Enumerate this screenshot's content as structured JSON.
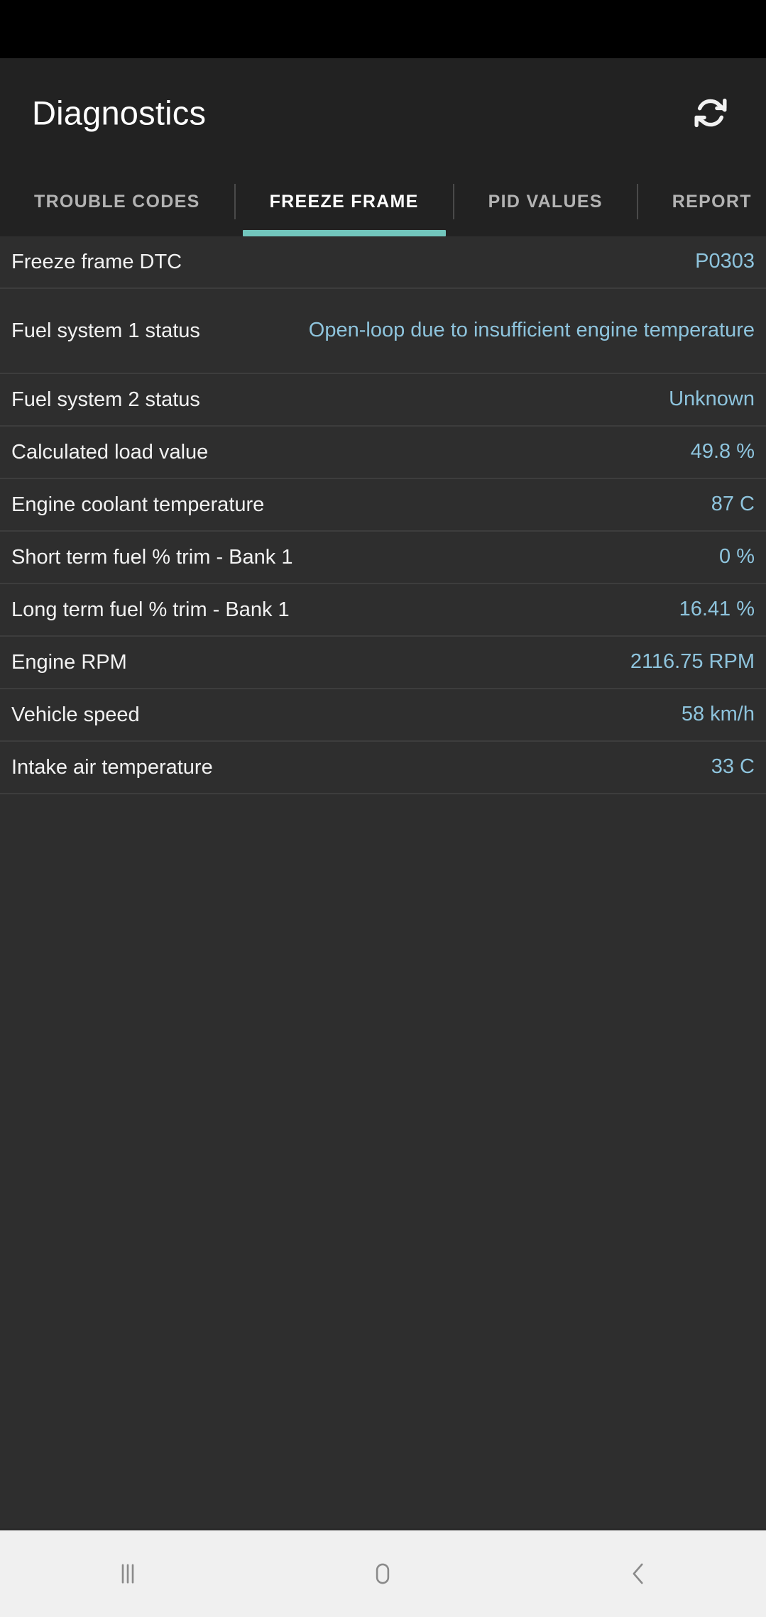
{
  "app": {
    "title": "Diagnostics",
    "refresh_icon": "refresh-icon",
    "accent_color": "#72c6bd",
    "value_color": "#8ec4dd",
    "app_bar_bg": "#222222",
    "list_bg": "#2e2e2e",
    "status_bar_bg": "#000000",
    "nav_bar_bg": "#f0f0f0"
  },
  "tabs": [
    {
      "label": "TROUBLE CODES",
      "active": false
    },
    {
      "label": "FREEZE FRAME",
      "active": true
    },
    {
      "label": "PID VALUES",
      "active": false
    },
    {
      "label": "REPORT",
      "active": false
    }
  ],
  "freeze_frame_rows": [
    {
      "label": "Freeze frame DTC",
      "value": "P0303"
    },
    {
      "label": "Fuel system 1 status",
      "value": "Open-loop due to insufficient engine temperature"
    },
    {
      "label": "Fuel system 2 status",
      "value": "Unknown"
    },
    {
      "label": "Calculated load value",
      "value": "49.8 %"
    },
    {
      "label": "Engine coolant temperature",
      "value": "87 C"
    },
    {
      "label": "Short term fuel % trim - Bank 1",
      "value": "0 %"
    },
    {
      "label": "Long term fuel % trim - Bank 1",
      "value": "16.41 %"
    },
    {
      "label": "Engine RPM",
      "value": "2116.75 RPM"
    },
    {
      "label": "Vehicle speed",
      "value": "58 km/h"
    },
    {
      "label": "Intake air temperature",
      "value": "33 C"
    }
  ],
  "nav": {
    "recents_icon": "recents-icon",
    "home_icon": "home-icon",
    "back_icon": "back-icon"
  }
}
